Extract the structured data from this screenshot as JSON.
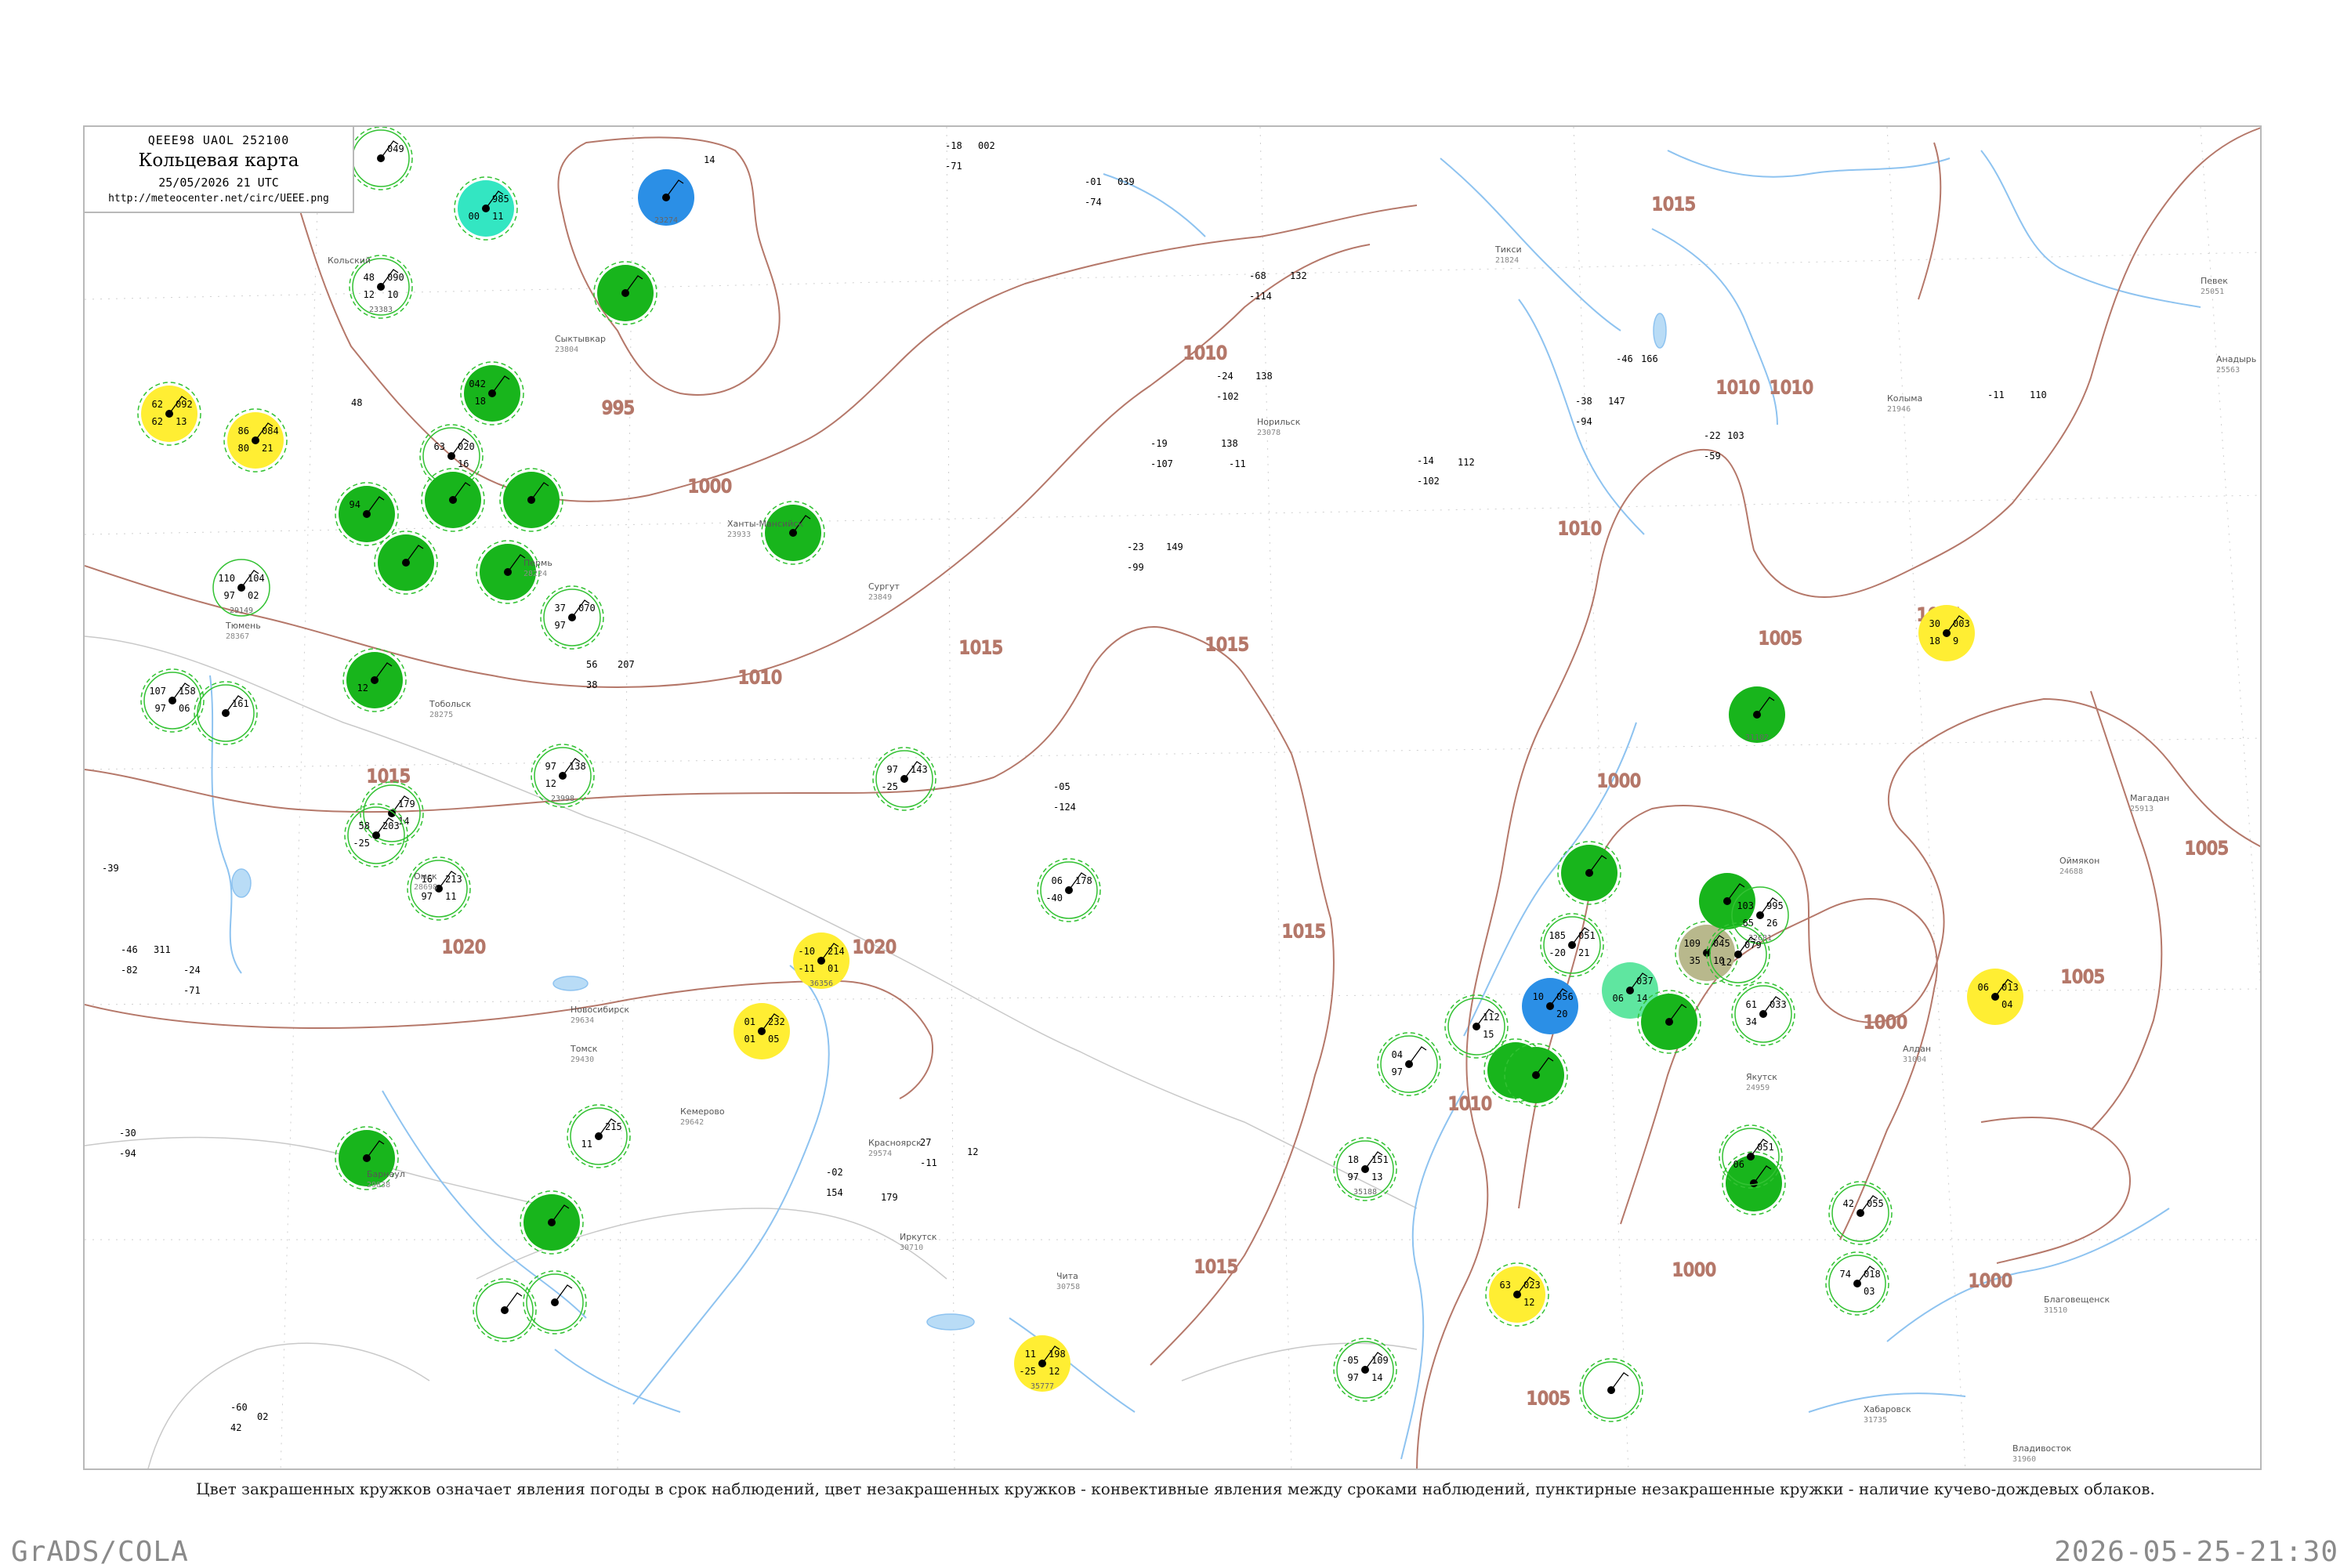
{
  "header": {
    "code_line": "QEEE98  UAOL  252100",
    "title": "Кольцевая карта",
    "datetime": "25/05/2026 21 UTC",
    "url": "http://meteocenter.net/circ/UEEE.png"
  },
  "caption": "Цвет закрашенных кружков означает явления погоды в срок наблюдений, цвет незакрашенных кружков - конвективные явления между сроками наблюдений, пунктирные незакрашенные кружки - наличие кучево-дождевых облаков.",
  "footer": {
    "left": "GrADS/COLA",
    "right": "2026-05-25-21:30"
  },
  "colors": {
    "isobar": "#b5786a",
    "river": "#8ec3f0",
    "border": "#c8c8c8",
    "green_fill": "#18b51c",
    "blue_fill": "#2b8fe6",
    "yellow_fill": "#ffee33",
    "cyan_fill": "#33e6c2",
    "khaki_fill": "#b8b88c",
    "dashed_green": "#33c233"
  },
  "isobar_labels": [
    "995",
    "1000",
    "1005",
    "1010",
    "1015",
    "1020"
  ],
  "stations": [
    {
      "fill": "none",
      "dash": true,
      "tl": "",
      "tr": "049",
      "bl": "",
      "br": "",
      "name": ""
    },
    {
      "fill": "cyan",
      "dash": true,
      "tl": "",
      "tr": "985",
      "bl": "00",
      "br": "11",
      "name": ""
    },
    {
      "fill": "blue",
      "dash": false,
      "tl": "",
      "tr": "",
      "bl": "",
      "br": "",
      "name": "23274"
    },
    {
      "fill": "green",
      "dash": true,
      "tl": "",
      "tr": "",
      "bl": "",
      "br": "",
      "name": ""
    },
    {
      "fill": "none",
      "dash": true,
      "tl": "48",
      "tr": "090",
      "bl": "12",
      "br": "10",
      "name": "23383"
    },
    {
      "fill": "green",
      "dash": true,
      "tl": "042",
      "tr": "",
      "bl": "18",
      "br": "",
      "name": ""
    },
    {
      "fill": "none",
      "dash": true,
      "tl": "63",
      "tr": "020",
      "bl": "",
      "br": "16",
      "name": ""
    },
    {
      "fill": "green",
      "dash": true,
      "tl": "",
      "tr": "",
      "bl": "",
      "br": "",
      "name": ""
    },
    {
      "fill": "green",
      "dash": true,
      "tl": "",
      "tr": "",
      "bl": "",
      "br": "",
      "name": ""
    },
    {
      "fill": "green",
      "dash": true,
      "tl": "94",
      "tr": "",
      "bl": "",
      "br": "",
      "name": ""
    },
    {
      "fill": "green",
      "dash": true,
      "tl": "",
      "tr": "",
      "bl": "",
      "br": "",
      "name": ""
    },
    {
      "fill": "green",
      "dash": true,
      "tl": "",
      "tr": "",
      "bl": "",
      "br": "",
      "name": ""
    },
    {
      "fill": "green",
      "dash": true,
      "tl": "",
      "tr": "",
      "bl": "",
      "br": "",
      "name": ""
    },
    {
      "fill": "yellow",
      "dash": true,
      "tl": "86",
      "tr": "084",
      "bl": "80",
      "br": "21",
      "name": ""
    },
    {
      "fill": "yellow",
      "dash": true,
      "tl": "62",
      "tr": "092",
      "bl": "62",
      "br": "13",
      "name": ""
    },
    {
      "fill": "none",
      "dash": false,
      "tl": "110",
      "tr": "104",
      "bl": "97",
      "br": "02",
      "name": "29149"
    },
    {
      "fill": "none",
      "dash": true,
      "tl": "37",
      "tr": "070",
      "bl": "97",
      "br": "",
      "name": ""
    },
    {
      "fill": "green",
      "dash": true,
      "tl": "",
      "tr": "",
      "bl": "12",
      "br": "",
      "name": ""
    },
    {
      "fill": "none",
      "dash": true,
      "tl": "107",
      "tr": "158",
      "bl": "97",
      "br": "06",
      "name": ""
    },
    {
      "fill": "none",
      "dash": true,
      "tl": "",
      "tr": "161",
      "bl": "",
      "br": "",
      "name": ""
    },
    {
      "fill": "none",
      "dash": true,
      "tl": "97",
      "tr": "138",
      "bl": "12",
      "br": "",
      "name": "23998"
    },
    {
      "fill": "none",
      "dash": true,
      "tl": "97",
      "tr": "143",
      "bl": "-25",
      "br": "",
      "name": ""
    },
    {
      "fill": "none",
      "dash": true,
      "tl": "",
      "tr": "179",
      "bl": "",
      "br": "14",
      "name": ""
    },
    {
      "fill": "none",
      "dash": true,
      "tl": "58",
      "tr": "203",
      "bl": "-25",
      "br": "",
      "name": ""
    },
    {
      "fill": "none",
      "dash": true,
      "tl": "16",
      "tr": "213",
      "bl": "97",
      "br": "11",
      "name": ""
    },
    {
      "fill": "none",
      "dash": true,
      "tl": "06",
      "tr": "178",
      "bl": "-40",
      "br": "",
      "name": ""
    },
    {
      "fill": "yellow",
      "dash": false,
      "tl": "-10",
      "tr": "214",
      "bl": "-11",
      "br": "01",
      "name": "36356"
    },
    {
      "fill": "yellow",
      "dash": false,
      "tl": "01",
      "tr": "232",
      "bl": "01",
      "br": "05",
      "name": ""
    },
    {
      "fill": "green",
      "dash": true,
      "tl": "",
      "tr": "",
      "bl": "",
      "br": "",
      "name": ""
    },
    {
      "fill": "none",
      "dash": true,
      "tl": "",
      "tr": "215",
      "bl": "11",
      "br": "",
      "name": ""
    },
    {
      "fill": "green",
      "dash": true,
      "tl": "",
      "tr": "",
      "bl": "",
      "br": "",
      "name": ""
    },
    {
      "fill": "none",
      "dash": true,
      "tl": "",
      "tr": "",
      "bl": "",
      "br": "",
      "name": ""
    },
    {
      "fill": "none",
      "dash": true,
      "tl": "",
      "tr": "",
      "bl": "",
      "br": "",
      "name": ""
    },
    {
      "fill": "yellow",
      "dash": false,
      "tl": "11",
      "tr": "198",
      "bl": "-25",
      "br": "12",
      "name": "35777"
    },
    {
      "fill": "none",
      "dash": true,
      "tl": "18",
      "tr": "151",
      "bl": "97",
      "br": "13",
      "name": "35188"
    },
    {
      "fill": "none",
      "dash": true,
      "tl": "-05",
      "tr": "109",
      "bl": "97",
      "br": "14",
      "name": ""
    },
    {
      "fill": "none",
      "dash": true,
      "tl": "04",
      "tr": "",
      "bl": "97",
      "br": "",
      "name": ""
    },
    {
      "fill": "green",
      "dash": true,
      "tl": "",
      "tr": "",
      "bl": "",
      "br": "",
      "name": ""
    },
    {
      "fill": "none",
      "dash": true,
      "tl": "",
      "tr": "112",
      "bl": "",
      "br": "15",
      "name": ""
    },
    {
      "fill": "green",
      "dash": true,
      "tl": "",
      "tr": "",
      "bl": "",
      "br": "",
      "name": ""
    },
    {
      "fill": "none",
      "dash": true,
      "tl": "185",
      "tr": "051",
      "bl": "-20",
      "br": "21",
      "name": ""
    },
    {
      "fill": "blue",
      "dash": false,
      "tl": "10",
      "tr": "056",
      "bl": "",
      "br": "20",
      "name": ""
    },
    {
      "fill": "cyan2",
      "dash": false,
      "tl": "",
      "tr": "037",
      "bl": "06",
      "br": "14",
      "name": ""
    },
    {
      "fill": "green",
      "dash": true,
      "tl": "",
      "tr": "",
      "bl": "",
      "br": "",
      "name": ""
    },
    {
      "fill": "khaki",
      "dash": true,
      "tl": "109",
      "tr": "045",
      "bl": "35",
      "br": "10",
      "name": ""
    },
    {
      "fill": "green",
      "dash": true,
      "tl": "",
      "tr": "",
      "bl": "",
      "br": "",
      "name": ""
    },
    {
      "fill": "green",
      "dash": false,
      "tl": "",
      "tr": "",
      "bl": "",
      "br": "",
      "name": ""
    },
    {
      "fill": "none",
      "dash": false,
      "tl": "103",
      "tr": "995",
      "bl": "65",
      "br": "26",
      "name": "32681"
    },
    {
      "fill": "green",
      "dash": true,
      "tl": "",
      "tr": "",
      "bl": "",
      "br": "",
      "name": ""
    },
    {
      "fill": "none",
      "dash": true,
      "tl": "",
      "tr": "079",
      "bl": "12",
      "br": "",
      "name": ""
    },
    {
      "fill": "none",
      "dash": true,
      "tl": "61",
      "tr": "033",
      "bl": "34",
      "br": "",
      "name": ""
    },
    {
      "fill": "green",
      "dash": false,
      "tl": "",
      "tr": "",
      "bl": "",
      "br": "",
      "name": "31102"
    },
    {
      "fill": "yellow",
      "dash": false,
      "tl": "30",
      "tr": "003",
      "bl": "18",
      "br": "9",
      "name": ""
    },
    {
      "fill": "yellow",
      "dash": false,
      "tl": "06",
      "tr": "013",
      "bl": "",
      "br": "04",
      "name": ""
    },
    {
      "fill": "none",
      "dash": true,
      "tl": "",
      "tr": "051",
      "bl": "06",
      "br": "",
      "name": ""
    },
    {
      "fill": "none",
      "dash": true,
      "tl": "42",
      "tr": "055",
      "bl": "",
      "br": "",
      "name": ""
    },
    {
      "fill": "none",
      "dash": true,
      "tl": "74",
      "tr": "018",
      "bl": "",
      "br": "03",
      "name": ""
    },
    {
      "fill": "yellow",
      "dash": true,
      "tl": "63",
      "tr": "023",
      "bl": "",
      "br": "12",
      "name": ""
    },
    {
      "fill": "none",
      "dash": true,
      "tl": "",
      "tr": "",
      "bl": "",
      "br": "",
      "name": ""
    }
  ],
  "place_labels": [
    {
      "l1": "Кольский",
      "l2": ""
    },
    {
      "l1": "Сыктывкар",
      "l2": "23804"
    },
    {
      "l1": "Пермь",
      "l2": "28224"
    },
    {
      "l1": "Тюмень",
      "l2": "28367"
    },
    {
      "l1": "Ханты-Мансийск",
      "l2": "23933"
    },
    {
      "l1": "Сургут",
      "l2": "23849"
    },
    {
      "l1": "Тобольск",
      "l2": "28275"
    },
    {
      "l1": "Омск",
      "l2": "28698"
    },
    {
      "l1": "Новосибирск",
      "l2": "29634"
    },
    {
      "l1": "Томск",
      "l2": "29430"
    },
    {
      "l1": "Кемерово",
      "l2": "29642"
    },
    {
      "l1": "Барнаул",
      "l2": "29838"
    },
    {
      "l1": "Красноярск",
      "l2": "29574"
    },
    {
      "l1": "Иркутск",
      "l2": "30710"
    },
    {
      "l1": "Чита",
      "l2": "30758"
    },
    {
      "l1": "Якутск",
      "l2": "24959"
    },
    {
      "l1": "Хабаровск",
      "l2": "31735"
    },
    {
      "l1": "Магадан",
      "l2": "25913"
    },
    {
      "l1": "Норильск",
      "l2": "23078"
    },
    {
      "l1": "Тикси",
      "l2": "21824"
    },
    {
      "l1": "Колыма",
      "l2": "21946"
    },
    {
      "l1": "Певек",
      "l2": "25051"
    },
    {
      "l1": "Анадырь",
      "l2": "25563"
    },
    {
      "l1": "Оймякон",
      "l2": "24688"
    },
    {
      "l1": "Алдан",
      "l2": "31004"
    },
    {
      "l1": "Благовещенск",
      "l2": "31510"
    },
    {
      "l1": "Владивосток",
      "l2": "31960"
    }
  ],
  "extra_numbers": [
    {
      "text": "14"
    },
    {
      "text": "48"
    },
    {
      "text": "56"
    },
    {
      "text": "38"
    },
    {
      "text": "207"
    },
    {
      "text": "-05"
    },
    {
      "text": "-124"
    },
    {
      "text": "-19"
    },
    {
      "text": "-107"
    },
    {
      "text": "138"
    },
    {
      "text": "-11"
    },
    {
      "text": "27"
    },
    {
      "text": "-11"
    },
    {
      "text": "12"
    },
    {
      "text": "-02"
    },
    {
      "text": "154"
    },
    {
      "text": "179"
    },
    {
      "text": "-14"
    },
    {
      "text": "-102"
    },
    {
      "text": "112"
    },
    {
      "text": "-22"
    },
    {
      "text": "103"
    },
    {
      "text": "-59"
    },
    {
      "text": "-46"
    },
    {
      "text": "166"
    },
    {
      "text": "-11"
    },
    {
      "text": "110"
    },
    {
      "text": "-38"
    },
    {
      "text": "147"
    },
    {
      "text": "-94"
    },
    {
      "text": "-68"
    },
    {
      "text": "132"
    },
    {
      "text": "-114"
    },
    {
      "text": "-24"
    },
    {
      "text": "138"
    },
    {
      "text": "-102"
    },
    {
      "text": "-23"
    },
    {
      "text": "149"
    },
    {
      "text": "-99"
    },
    {
      "text": "-01"
    },
    {
      "text": "039"
    },
    {
      "text": "-74"
    },
    {
      "text": "-18"
    },
    {
      "text": "002"
    },
    {
      "text": "-71"
    },
    {
      "text": "-60"
    },
    {
      "text": "42"
    },
    {
      "text": "02"
    },
    {
      "text": "-30"
    },
    {
      "text": "-94"
    },
    {
      "text": "-39"
    },
    {
      "text": "-46"
    },
    {
      "text": "311"
    },
    {
      "text": "-82"
    },
    {
      "text": "-24"
    },
    {
      "text": "-71"
    }
  ]
}
